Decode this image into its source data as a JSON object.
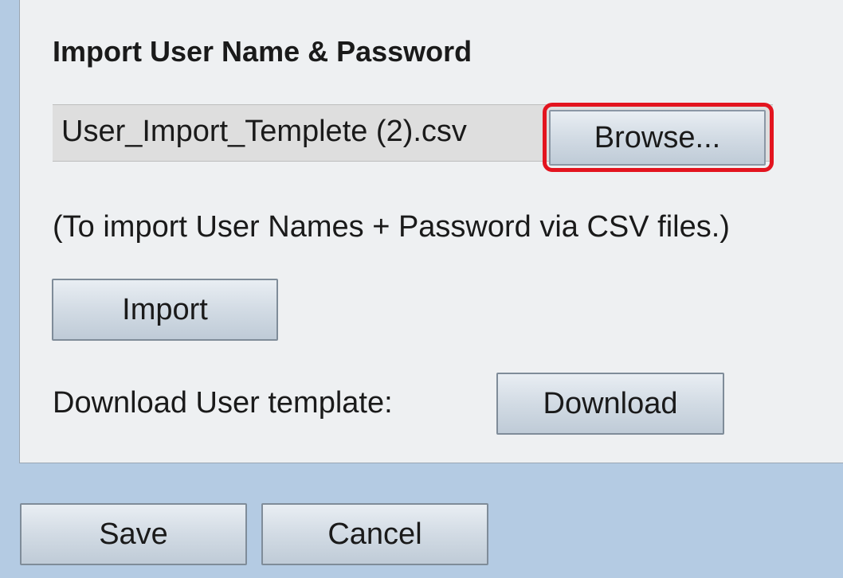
{
  "import_section": {
    "title": "Import User Name & Password",
    "file_name": "User_Import_Templete (2).csv",
    "browse_label": "Browse...",
    "hint": "(To import User Names + Password via CSV files.)",
    "import_label": "Import"
  },
  "download_section": {
    "label": "Download User template:",
    "download_label": "Download"
  },
  "footer": {
    "save_label": "Save",
    "cancel_label": "Cancel"
  },
  "colors": {
    "page_background": "#b4cbe3",
    "panel_background": "#eef0f2",
    "highlight": "#e3141f"
  }
}
